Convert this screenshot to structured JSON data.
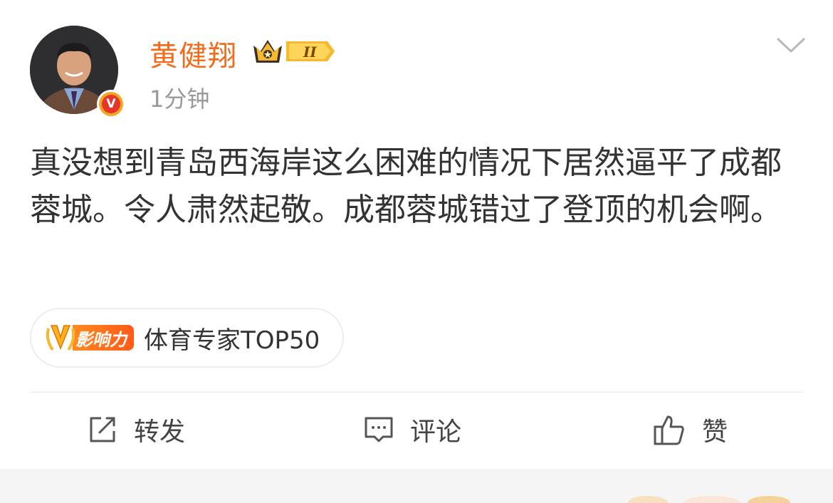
{
  "user": {
    "name": "黄健翔",
    "vip_level": "II",
    "verified": true
  },
  "post": {
    "time": "1分钟",
    "text": "真没想到青岛西海岸这么困难的情况下居然逼平了成都蓉城。令人肃然起敬。成都蓉城错过了登顶的机会啊。"
  },
  "topic": {
    "badge_label": "影响力",
    "label": "体育专家TOP50"
  },
  "actions": {
    "repost_label": "转发",
    "comment_label": "评论",
    "like_label": "赞"
  },
  "colors": {
    "username": "#f26c1b",
    "vip_gold": "#f5b82e",
    "verified_red": "#e6362a",
    "influence_orange": "#ff6a1a"
  },
  "icons": {
    "dropdown": "chevron-down-icon",
    "repost": "share-box-icon",
    "comment": "comment-bubble-icon",
    "like": "thumbs-up-icon"
  }
}
